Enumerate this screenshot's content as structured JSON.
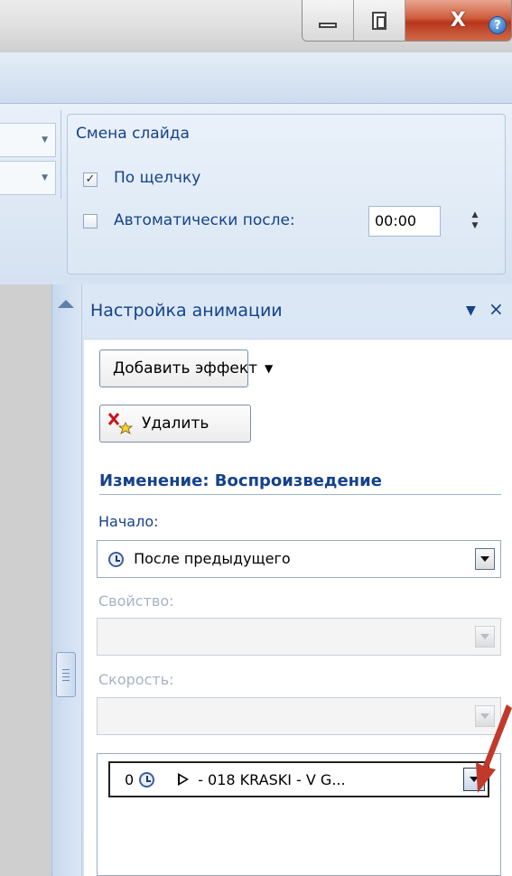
{
  "window": {
    "minimize_icon": "minimize-icon",
    "restore_icon": "restore-icon",
    "close_label": "X",
    "close_color": "#c84a2c",
    "help_label": "?"
  },
  "ribbon": {
    "transition_group": {
      "title": "Смена слайда",
      "on_click": {
        "label": "По щелчку",
        "checked": true,
        "mark": "✓"
      },
      "auto_after": {
        "label": "Автоматически после:",
        "checked": false,
        "value": "00:00"
      }
    }
  },
  "task_pane": {
    "title": "Настройка анимации",
    "menu_glyph": "▼",
    "close_glyph": "×",
    "add_effect_label": "Добавить эффект",
    "add_effect_arrow": "▼",
    "remove_label": "Удалить",
    "change_heading": "Изменение: Воспроизведение",
    "start": {
      "label": "Начало:",
      "value": "После предыдущего"
    },
    "property": {
      "label": "Свойство:",
      "value": ""
    },
    "speed": {
      "label": "Скорость:",
      "value": ""
    },
    "effects_list": [
      {
        "index": "0",
        "name": "- 018 KRASKI - V G..."
      }
    ]
  },
  "colors": {
    "ribbon_text": "#15428b",
    "pane_bg": "#d2e1f3",
    "annotation_arrow": "#c0392b"
  }
}
